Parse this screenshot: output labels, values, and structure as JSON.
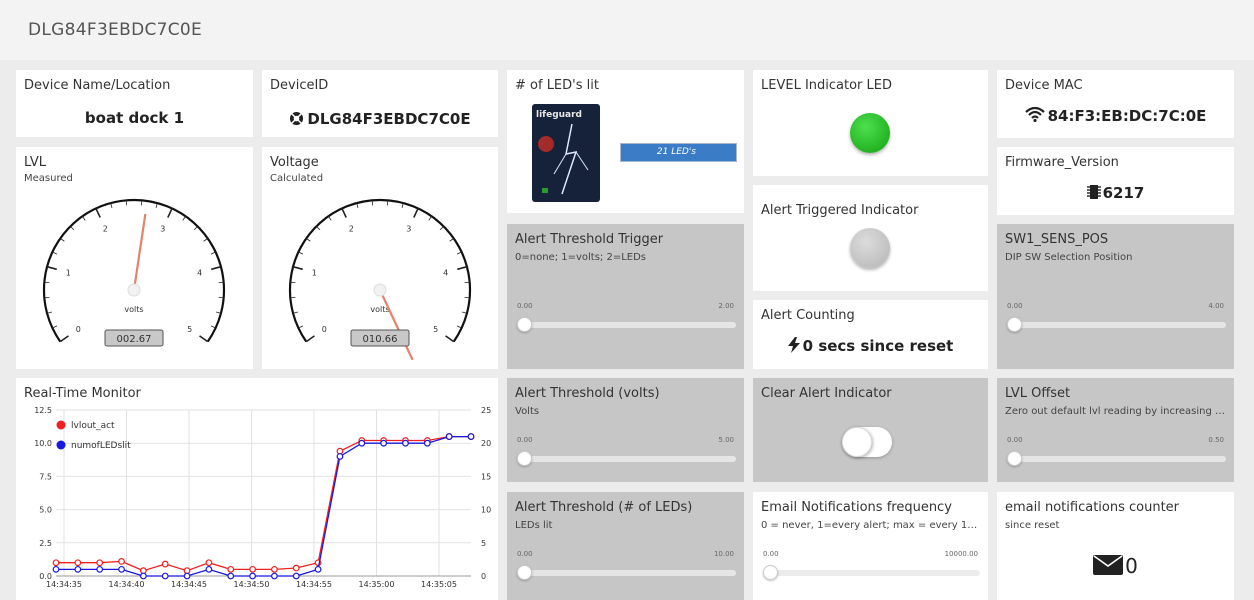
{
  "header": {
    "title": "DLG84F3EBDC7C0E"
  },
  "cards": {
    "device_name": {
      "title": "Device Name/Location",
      "value": "boat dock 1"
    },
    "device_id": {
      "title": "DeviceID",
      "value": "DLG84F3EBDC7C0E",
      "icon": "life-ring-icon"
    },
    "leds_lit": {
      "title": "# of LED's lit",
      "badge": "21 LED's",
      "image_label": "lifeguard",
      "bar_fill_fraction": 0.175
    },
    "level_led": {
      "title": "LEVEL Indicator LED",
      "color": "#1fb51f"
    },
    "device_mac": {
      "title": "Device MAC",
      "value": "84:F3:EB:DC:7C:0E",
      "icon": "wifi-icon"
    },
    "lvl": {
      "title": "LVL",
      "subtitle": "Measured",
      "unit": "volts",
      "value": "002.67",
      "ticks": [
        "0",
        "1",
        "2",
        "3",
        "4",
        "5"
      ],
      "min": 0,
      "max": 5,
      "reading": 2.67
    },
    "voltage": {
      "title": "Voltage",
      "subtitle": "Calculated",
      "unit": "volts",
      "value": "010.66",
      "ticks": [
        "0",
        "1",
        "2",
        "3",
        "4",
        "5"
      ],
      "min": 0,
      "max": 5,
      "reading": 10.66
    },
    "alert_triggered": {
      "title": "Alert Triggered Indicator",
      "color": "#c8c8c8"
    },
    "firmware": {
      "title": "Firmware_Version",
      "value": "6217",
      "icon": "chip-icon"
    },
    "alert_threshold_trigger": {
      "title": "Alert Threshold Trigger",
      "subtitle": "0=none; 1=volts; 2=LEDs",
      "min": "0.00",
      "max": "2.00",
      "value": 0
    },
    "sw1_sens_pos": {
      "title": "SW1_SENS_POS",
      "subtitle": "DIP SW Selection Position",
      "min": "0.00",
      "max": "4.00",
      "value": 0
    },
    "alert_counting": {
      "title": "Alert Counting",
      "value": "0 secs since reset",
      "icon": "bolt-icon"
    },
    "alert_threshold_volts": {
      "title": "Alert Threshold (volts)",
      "subtitle": "Volts",
      "min": "0.00",
      "max": "5.00",
      "value": 0
    },
    "clear_alert": {
      "title": "Clear Alert Indicator",
      "state": "off"
    },
    "lvl_offset": {
      "title": "LVL Offset",
      "subtitle": "Zero out default lvl reading by increasing t...",
      "min": "0.00",
      "max": "0.50",
      "value": 0
    },
    "alert_threshold_leds": {
      "title": "Alert Threshold (# of LEDs)",
      "subtitle": "LEDs lit",
      "min": "0.00",
      "max": "10.00",
      "value": 0
    },
    "email_freq": {
      "title": "Email Notifications frequency",
      "subtitle": "0 = never, 1=every alert; max = every 10,000...",
      "min": "0.00",
      "max": "10000.00",
      "value": 0
    },
    "email_counter": {
      "title": "email notifications counter",
      "subtitle": "since reset",
      "value": "0",
      "icon": "envelope-icon"
    }
  },
  "chart_data": {
    "type": "line",
    "title": "Real-Time Monitor",
    "x": [
      "14:34:33",
      "14:34:35",
      "14:34:37",
      "14:34:39",
      "14:34:41",
      "14:34:43",
      "14:34:45",
      "14:34:47",
      "14:34:49",
      "14:34:51",
      "14:34:53",
      "14:34:55",
      "14:34:57",
      "14:34:59",
      "14:35:01",
      "14:35:03",
      "14:35:05",
      "14:35:07"
    ],
    "xticks": [
      "14:34:35",
      "14:34:40",
      "14:34:45",
      "14:34:50",
      "14:34:55",
      "14:35:00",
      "14:35:05"
    ],
    "y_left_ticks": [
      "0.0",
      "2.5",
      "5.0",
      "7.5",
      "10.0",
      "12.5"
    ],
    "y_right_ticks": [
      "0",
      "5",
      "10",
      "15",
      "20",
      "25"
    ],
    "ylim_left": [
      0,
      12.5
    ],
    "ylim_right": [
      0,
      25
    ],
    "series": [
      {
        "name": "lvlout_act",
        "color": "#f02020",
        "axis": "left",
        "values": [
          1.0,
          1.0,
          1.0,
          1.1,
          0.4,
          0.9,
          0.4,
          1.0,
          0.5,
          0.5,
          0.5,
          0.6,
          1.0,
          9.4,
          10.2,
          10.2,
          10.2,
          10.2,
          10.5,
          10.5
        ]
      },
      {
        "name": "numofLEDslit",
        "color": "#1818e0",
        "axis": "right",
        "values": [
          1,
          1,
          1,
          1,
          0,
          0,
          0,
          1,
          0,
          0,
          0,
          0,
          1,
          18,
          20,
          20,
          20,
          20,
          21,
          21
        ]
      }
    ],
    "grid": true,
    "legend": "top-left"
  }
}
